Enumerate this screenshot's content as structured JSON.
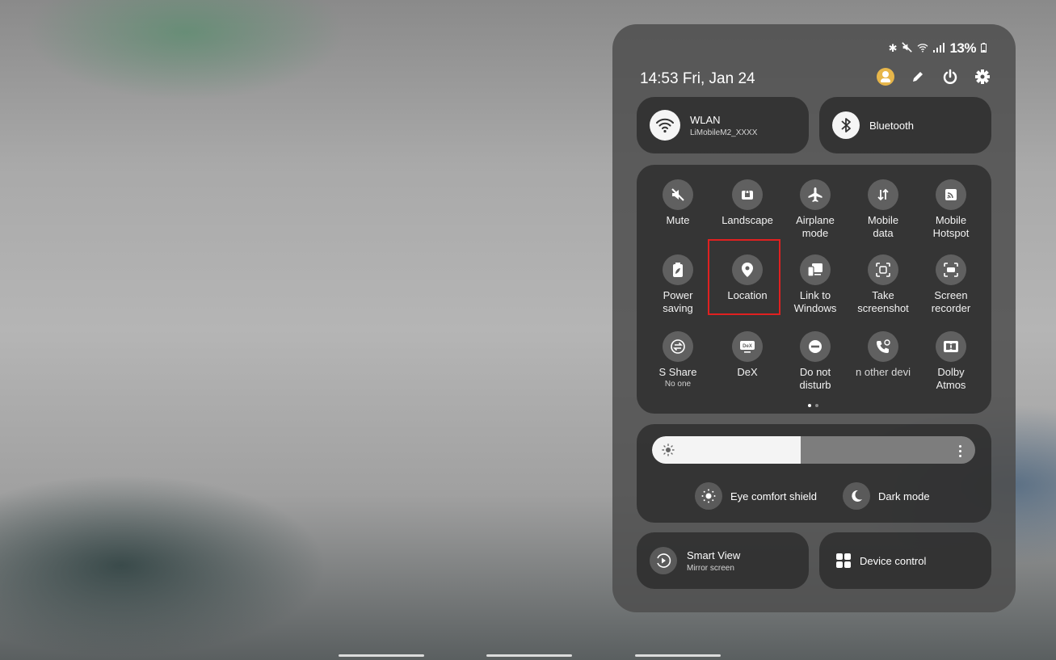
{
  "status_bar": {
    "battery": "13%"
  },
  "header": {
    "time": "14:53",
    "date": "Fri, Jan 24"
  },
  "wlan": {
    "title": "WLAN",
    "network": "LiMobileM2_XXXX"
  },
  "bluetooth": {
    "title": "Bluetooth"
  },
  "toggles": [
    {
      "label": "Mute",
      "icon": "mute-icon"
    },
    {
      "label": "Landscape",
      "icon": "landscape-lock-icon"
    },
    {
      "label": "Airplane\nmode",
      "icon": "airplane-icon"
    },
    {
      "label": "Mobile\ndata",
      "icon": "mobile-data-icon"
    },
    {
      "label": "Mobile\nHotspot",
      "icon": "hotspot-icon"
    },
    {
      "label": "Power\nsaving",
      "icon": "battery-leaf-icon"
    },
    {
      "label": "Location",
      "icon": "location-pin-icon"
    },
    {
      "label": "Link to\nWindows",
      "icon": "link-windows-icon"
    },
    {
      "label": "Take\nscreenshot",
      "icon": "screenshot-icon"
    },
    {
      "label": "Screen\nrecorder",
      "icon": "screen-recorder-icon"
    },
    {
      "label": "S Share",
      "sub": "No one",
      "icon": "s-share-icon"
    },
    {
      "label": "DeX",
      "icon": "dex-icon"
    },
    {
      "label": "Do not\ndisturb",
      "icon": "do-not-disturb-icon"
    },
    {
      "label": "n other devi",
      "icon": "call-other-devices-icon"
    },
    {
      "label": "Dolby\nAtmos",
      "icon": "dolby-icon"
    }
  ],
  "brightness": {
    "level": 0.46
  },
  "modes": {
    "eye_comfort": "Eye comfort shield",
    "dark_mode": "Dark mode"
  },
  "smart_view": {
    "title": "Smart View",
    "sub": "Mirror screen"
  },
  "device_control": {
    "title": "Device control"
  },
  "colors": {
    "highlight": "#e02020",
    "avatar": "#e7b64a"
  }
}
